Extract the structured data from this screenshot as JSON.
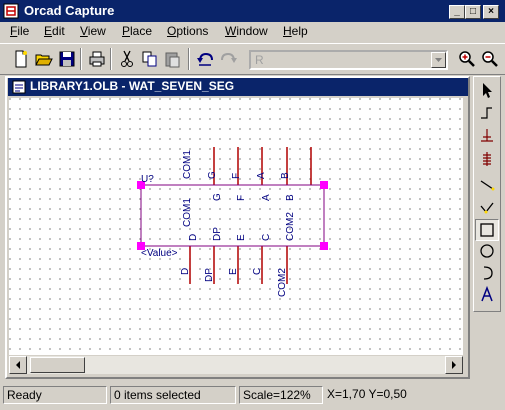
{
  "app": {
    "title": "Orcad Capture"
  },
  "window_controls": {
    "minimize": "_",
    "maximize": "□",
    "close": "×"
  },
  "menu": [
    {
      "label": "File",
      "accel": "F",
      "rest": "ile"
    },
    {
      "label": "Edit",
      "accel": "E",
      "rest": "dit"
    },
    {
      "label": "View",
      "accel": "V",
      "rest": "iew"
    },
    {
      "label": "Place",
      "accel": "P",
      "rest": "lace"
    },
    {
      "label": "Options",
      "accel": "O",
      "rest": "ptions"
    },
    {
      "label": "Window",
      "accel": "W",
      "rest": "indow"
    },
    {
      "label": "Help",
      "accel": "H",
      "rest": "elp"
    }
  ],
  "toolbar": {
    "buttons": [
      "new-icon",
      "open-icon",
      "save-icon",
      "print-icon",
      "cut-icon",
      "copy-icon",
      "paste-icon",
      "undo-icon",
      "redo-icon",
      "zoom-in-icon",
      "zoom-out-icon"
    ],
    "combo_value": "R"
  },
  "document": {
    "title": "LIBRARY1.OLB - WAT_SEVEN_SEG"
  },
  "part": {
    "reference": "U?",
    "value": "<Value>",
    "top_pins": [
      {
        "outer": "COM1",
        "inner": "COM1"
      },
      {
        "outer": "G",
        "inner": "G"
      },
      {
        "outer": "F",
        "inner": "F"
      },
      {
        "outer": "A",
        "inner": "A"
      },
      {
        "outer": "B",
        "inner": "B"
      }
    ],
    "bottom_pins": [
      {
        "outer": "D",
        "inner": "D"
      },
      {
        "outer": "DP",
        "inner": "DP"
      },
      {
        "outer": "E",
        "inner": "E"
      },
      {
        "outer": "C",
        "inner": "C"
      },
      {
        "outer": "COM2",
        "inner": "COM2"
      }
    ],
    "pin_color": "#b00000",
    "body_color": "#800080",
    "label_color": "#000080",
    "handle_color": "#ff00ff"
  },
  "palette": [
    "select-icon",
    "place-pin-icon",
    "place-pin-array-icon",
    "place-ieee-icon",
    "place-line-icon",
    "place-polyline-icon",
    "place-rectangle-icon",
    "place-ellipse-icon",
    "place-arc-icon",
    "place-text-icon"
  ],
  "status": {
    "state": "Ready",
    "selection": "0 items selected",
    "scale": "Scale=122%",
    "coords": "X=1,70  Y=0,50"
  }
}
